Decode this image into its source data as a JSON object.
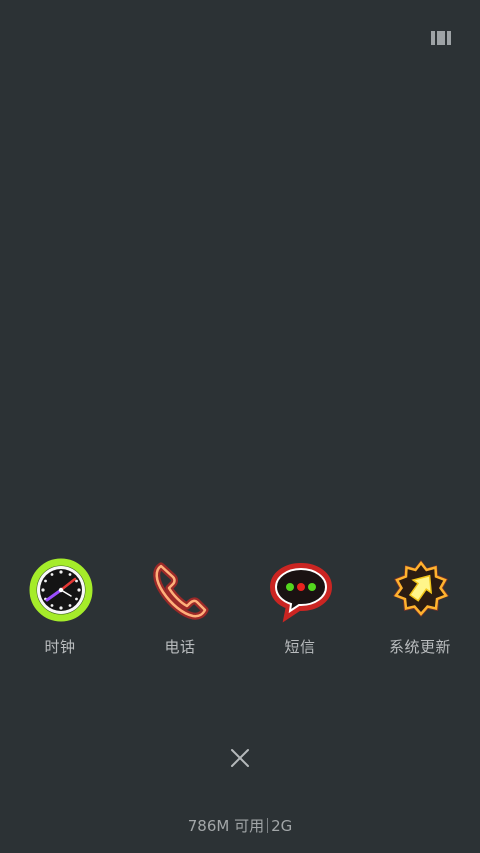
{
  "toolbar": {
    "view_toggle_icon": "card-view-icon"
  },
  "apps": [
    {
      "label": "时钟",
      "icon": "clock-icon"
    },
    {
      "label": "电话",
      "icon": "phone-icon"
    },
    {
      "label": "短信",
      "icon": "message-icon"
    },
    {
      "label": "系统更新",
      "icon": "system-update-icon"
    }
  ],
  "memory": {
    "available": "786M 可用",
    "total": "2G"
  },
  "close": {
    "icon": "close-icon"
  },
  "colors": {
    "background": "#2c3235",
    "label_text": "#b9bcbe",
    "neon_green": "#8fe01a",
    "neon_red": "#e8231f",
    "neon_yellow": "#f7e233"
  }
}
